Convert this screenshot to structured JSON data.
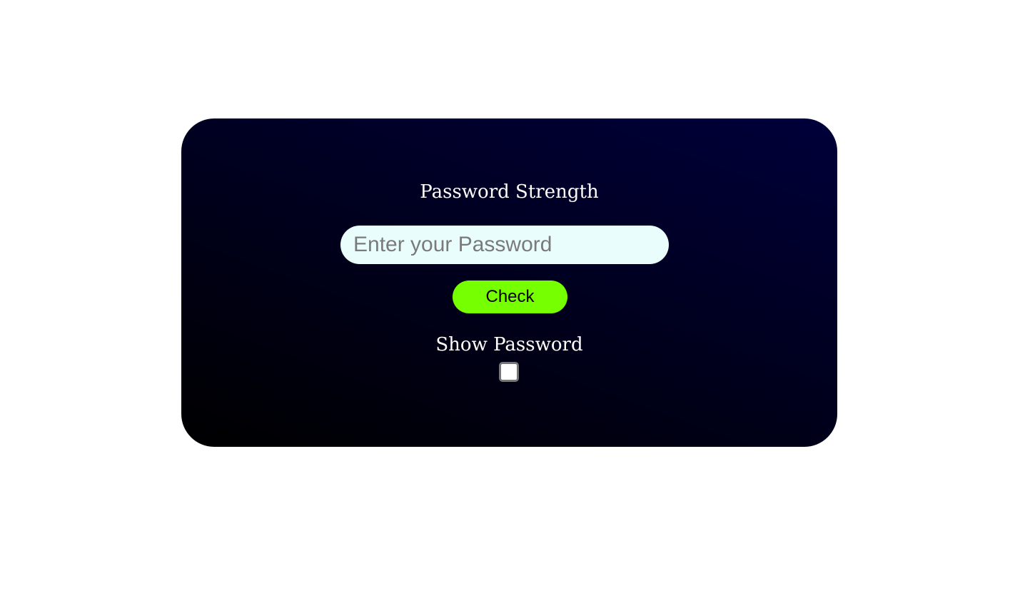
{
  "card": {
    "title": "Password Strength",
    "password_input": {
      "value": "",
      "placeholder": "Enter your Password"
    },
    "check_button": {
      "label": "Check",
      "color": "#76ff00"
    },
    "show_password": {
      "label": "Show Password",
      "checked": false
    },
    "colors": {
      "gradient_top": "#00003a",
      "gradient_bottom": "#000000",
      "input_background": "#e9fdfd"
    }
  }
}
